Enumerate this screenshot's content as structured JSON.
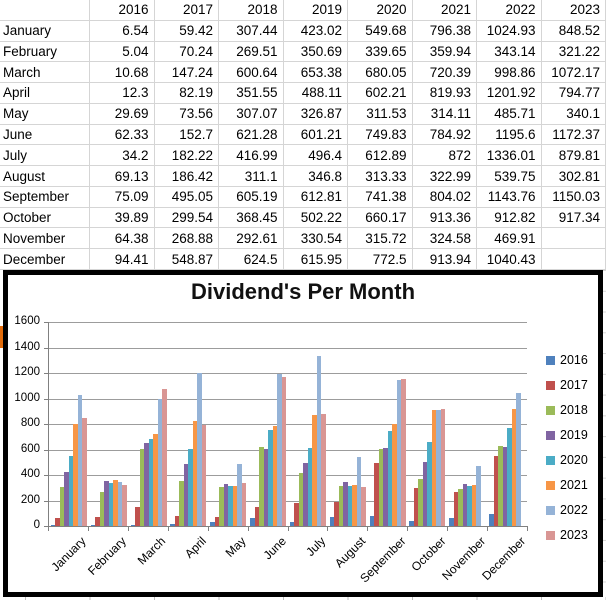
{
  "table": {
    "corner_label": "",
    "columns": [
      "2016",
      "2017",
      "2018",
      "2019",
      "2020",
      "2021",
      "2022",
      "2023"
    ],
    "rows": [
      {
        "month": "January",
        "values": [
          "6.54",
          "59.42",
          "307.44",
          "423.02",
          "549.68",
          "796.38",
          "1024.93",
          "848.52"
        ]
      },
      {
        "month": "February",
        "values": [
          "5.04",
          "70.24",
          "269.51",
          "350.69",
          "339.65",
          "359.94",
          "343.14",
          "321.22"
        ]
      },
      {
        "month": "March",
        "values": [
          "10.68",
          "147.24",
          "600.64",
          "653.38",
          "680.05",
          "720.39",
          "998.86",
          "1072.17"
        ]
      },
      {
        "month": "April",
        "values": [
          "12.3",
          "82.19",
          "351.55",
          "488.11",
          "602.21",
          "819.93",
          "1201.92",
          "794.77"
        ]
      },
      {
        "month": "May",
        "values": [
          "29.69",
          "73.56",
          "307.07",
          "326.87",
          "311.53",
          "314.11",
          "485.71",
          "340.1"
        ]
      },
      {
        "month": "June",
        "values": [
          "62.33",
          "152.7",
          "621.28",
          "601.21",
          "749.83",
          "784.92",
          "1195.6",
          "1172.37"
        ]
      },
      {
        "month": "July",
        "values": [
          "34.2",
          "182.22",
          "416.99",
          "496.4",
          "612.89",
          "872",
          "1336.01",
          "879.81"
        ]
      },
      {
        "month": "August",
        "values": [
          "69.13",
          "186.42",
          "311.1",
          "346.8",
          "313.33",
          "322.99",
          "539.75",
          "302.81"
        ]
      },
      {
        "month": "September",
        "values": [
          "75.09",
          "495.05",
          "605.19",
          "612.81",
          "741.38",
          "804.02",
          "1143.76",
          "1150.03"
        ]
      },
      {
        "month": "October",
        "values": [
          "39.89",
          "299.54",
          "368.45",
          "502.22",
          "660.17",
          "913.36",
          "912.82",
          "917.34"
        ]
      },
      {
        "month": "November",
        "values": [
          "64.38",
          "268.88",
          "292.61",
          "330.54",
          "315.72",
          "324.58",
          "469.91",
          ""
        ]
      },
      {
        "month": "December",
        "values": [
          "94.41",
          "548.87",
          "624.5",
          "615.95",
          "772.5",
          "913.94",
          "1040.43",
          ""
        ]
      }
    ]
  },
  "chart_data": {
    "type": "bar",
    "title": "Dividend's Per Month",
    "categories": [
      "January",
      "February",
      "March",
      "April",
      "May",
      "June",
      "July",
      "August",
      "September",
      "October",
      "November",
      "December"
    ],
    "series": [
      {
        "name": "2016",
        "color": "#4F81BD",
        "values": [
          6.54,
          5.04,
          10.68,
          12.3,
          29.69,
          62.33,
          34.2,
          69.13,
          75.09,
          39.89,
          64.38,
          94.41
        ]
      },
      {
        "name": "2017",
        "color": "#C0504D",
        "values": [
          59.42,
          70.24,
          147.24,
          82.19,
          73.56,
          152.7,
          182.22,
          186.42,
          495.05,
          299.54,
          268.88,
          548.87
        ]
      },
      {
        "name": "2018",
        "color": "#9BBB59",
        "values": [
          307.44,
          269.51,
          600.64,
          351.55,
          307.07,
          621.28,
          416.99,
          311.1,
          605.19,
          368.45,
          292.61,
          624.5
        ]
      },
      {
        "name": "2019",
        "color": "#8064A2",
        "values": [
          423.02,
          350.69,
          653.38,
          488.11,
          326.87,
          601.21,
          496.4,
          346.8,
          612.81,
          502.22,
          330.54,
          615.95
        ]
      },
      {
        "name": "2020",
        "color": "#4BACC6",
        "values": [
          549.68,
          339.65,
          680.05,
          602.21,
          311.53,
          749.83,
          612.89,
          313.33,
          741.38,
          660.17,
          315.72,
          772.5
        ]
      },
      {
        "name": "2021",
        "color": "#F79646",
        "values": [
          796.38,
          359.94,
          720.39,
          819.93,
          314.11,
          784.92,
          872,
          322.99,
          804.02,
          913.36,
          324.58,
          913.94
        ]
      },
      {
        "name": "2022",
        "color": "#95B3D7",
        "values": [
          1024.93,
          343.14,
          998.86,
          1201.92,
          485.71,
          1195.6,
          1336.01,
          539.75,
          1143.76,
          912.82,
          469.91,
          1040.43
        ]
      },
      {
        "name": "2023",
        "color": "#D99694",
        "values": [
          848.52,
          321.22,
          1072.17,
          794.77,
          340.1,
          1172.37,
          879.81,
          302.81,
          1150.03,
          917.34,
          null,
          null
        ]
      }
    ],
    "ylim": [
      0,
      1600
    ],
    "ytick_step": 200,
    "yticks": [
      0,
      200,
      400,
      600,
      800,
      1000,
      1200,
      1400,
      1600
    ],
    "xlabel": "",
    "ylabel": "",
    "grid": true,
    "legend_position": "right"
  },
  "colors": {
    "grid_line": "#9C9C9C",
    "axis_line": "#808080",
    "table_grid": "#D5D5D5",
    "chart_border": "#000000",
    "accent_strip": "#E26B0A"
  }
}
